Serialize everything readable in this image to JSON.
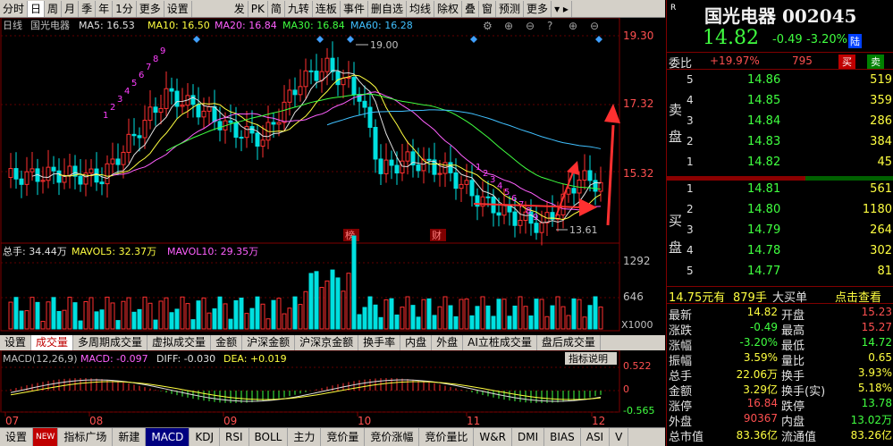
{
  "toolbar": {
    "items": [
      "分时",
      "日",
      "周",
      "月",
      "季",
      "年",
      "1分",
      "更多",
      "设置",
      "发",
      "PK",
      "简",
      "九转",
      "连板",
      "事件",
      "删自选",
      "均线",
      "除权",
      "叠",
      "窗",
      "预测",
      "更多"
    ],
    "active_index": 1
  },
  "chart": {
    "period": "日线",
    "stock": "国光电器",
    "ma5": "MA5: 16.53",
    "ma10": "MA10: 16.50",
    "ma20": "MA20: 16.84",
    "ma30": "MA30: 16.84",
    "ma60": "MA60: 16.28",
    "price_ticks": [
      "19.30",
      "17.32",
      "15.32"
    ],
    "high_label": "19.00",
    "low_label": "13.61",
    "markers": [
      "榜",
      "财"
    ],
    "seq_labels_a": [
      "1",
      "2",
      "3",
      "4",
      "5",
      "6",
      "7",
      "8",
      "9"
    ],
    "seq_labels_b": [
      "1",
      "2",
      "3",
      "4",
      "5",
      "6",
      "7",
      "8",
      "9"
    ],
    "vol_header_total": "总手: 34.44万",
    "vol_header_mavol5": "MAVOL5: 32.37万",
    "vol_header_mavol10": "MAVOL10: 29.35万",
    "vol_ticks": [
      "1292",
      "646",
      "X1000"
    ],
    "sub_tabs": [
      "设置",
      "成交量",
      "多周期成交量",
      "虚拟成交量",
      "金额",
      "沪深金额",
      "沪深京金额",
      "换手率",
      "内盘",
      "外盘",
      "AI立桩成交量",
      "盘后成交量"
    ],
    "sub_tab_active": 1,
    "macd_header": "MACD(12,26,9)",
    "macd_value": "MACD: -0.097",
    "dif_value": "DIFF: -0.030",
    "dea_value": "DEA: +0.019",
    "macd_button": "指标说明",
    "macd_ticks": [
      "0.522",
      "0",
      "-0.565"
    ],
    "months": [
      "07",
      "08",
      "09",
      "10",
      "11",
      "12"
    ]
  },
  "bottom_bar": [
    "设置",
    "NEW",
    "指标广场",
    "新建",
    "MACD",
    "KDJ",
    "RSI",
    "BOLL",
    "主力",
    "竞价量",
    "竞价涨幅",
    "竞价量比",
    "W&R",
    "DMI",
    "BIAS",
    "ASI",
    "V"
  ],
  "bottom_active": 4,
  "quote": {
    "name": "国光电器 002045",
    "price": "14.82",
    "change": "-0.49",
    "change_pct": "-3.20%",
    "tag": "陆",
    "wb_label": "委比",
    "wb_value": "+19.97%",
    "wb_count": "795",
    "buy_btn": "买",
    "sell_btn": "卖",
    "sell_label": [
      "卖",
      "盘"
    ],
    "buy_label": [
      "买",
      "盘"
    ],
    "asks": [
      {
        "level": "5",
        "price": "14.86",
        "vol": "519"
      },
      {
        "level": "4",
        "price": "14.85",
        "vol": "359"
      },
      {
        "level": "3",
        "price": "14.84",
        "vol": "286"
      },
      {
        "level": "2",
        "price": "14.83",
        "vol": "384"
      },
      {
        "level": "1",
        "price": "14.82",
        "vol": "45"
      }
    ],
    "bids": [
      {
        "level": "1",
        "price": "14.81",
        "vol": "561"
      },
      {
        "level": "2",
        "price": "14.80",
        "vol": "1180"
      },
      {
        "level": "3",
        "price": "14.79",
        "vol": "264"
      },
      {
        "level": "4",
        "price": "14.78",
        "vol": "302"
      },
      {
        "level": "5",
        "price": "14.77",
        "vol": "81"
      }
    ],
    "trade_price": "14.75元有",
    "trade_vol": "879手",
    "trade_type": "大买单",
    "trade_link": "点击查看",
    "stats": [
      {
        "l1": "最新",
        "v1": "14.82",
        "l2": "开盘",
        "v2": "15.23"
      },
      {
        "l1": "涨跌",
        "v1": "-0.49",
        "l2": "最高",
        "v2": "15.27"
      },
      {
        "l1": "涨幅",
        "v1": "-3.20%",
        "l2": "最低",
        "v2": "14.72"
      },
      {
        "l1": "振幅",
        "v1": "3.59%",
        "l2": "量比",
        "v2": "0.65"
      },
      {
        "l1": "总手",
        "v1": "22.06万",
        "l2": "换手",
        "v2": "3.93%"
      },
      {
        "l1": "金额",
        "v1": "3.29亿",
        "l2": "换手(实)",
        "v2": "5.18%"
      },
      {
        "l1": "涨停",
        "v1": "16.84",
        "l2": "跌停",
        "v2": "13.78"
      },
      {
        "l1": "外盘",
        "v1": "90367",
        "l2": "内盘",
        "v2": "13.02万"
      },
      {
        "l1": "总市值",
        "v1": "83.36亿",
        "l2": "流通值",
        "v2": "83.26亿"
      }
    ]
  }
}
